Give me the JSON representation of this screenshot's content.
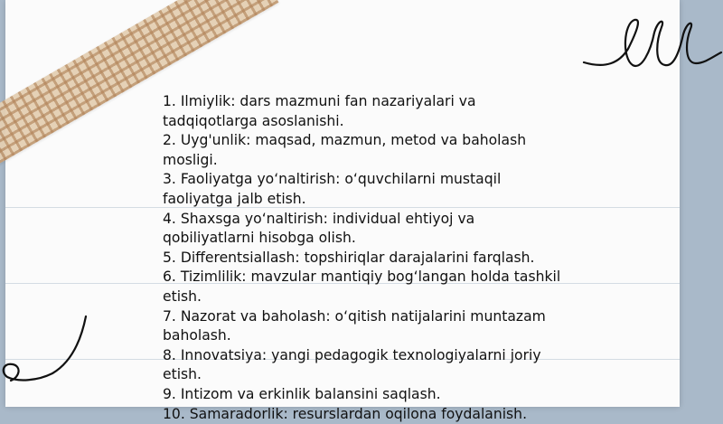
{
  "document": {
    "items": [
      "1. Ilmiylik: dars mazmuni fan nazariyalari va tadqiqotlarga asoslanishi.",
      "2. Uyg'unlik: maqsad, mazmun, metod va baholash mosligi.",
      "3. Faoliyatga yo‘naltirish: o‘quvchilarni mustaqil faoliyatga jalb etish.",
      "4. Shaxsga yo‘naltirish: individual ehtiyoj va qobiliyatlarni hisobga olish.",
      "5. Differentsiallash: topshiriqlar darajalarini farqlash.",
      "6. Tizimlilik: mavzular mantiqiy bog‘langan holda tashkil etish.",
      "7. Nazorat va baholash: o‘qitish natijalarini muntazam baholash.",
      "8. Innovatsiya: yangi pedagogik texnologiyalarni joriy etish.",
      "9. Intizom va erkinlik balansini saqlash.",
      "10. Samaradorlik: resurslardan oqilona foydalanish."
    ]
  },
  "colors": {
    "background": "#a9b9c9",
    "paper": "#fbfbfb",
    "text": "#111111",
    "tape": "#e4cfb3",
    "doodle": "#111111"
  }
}
